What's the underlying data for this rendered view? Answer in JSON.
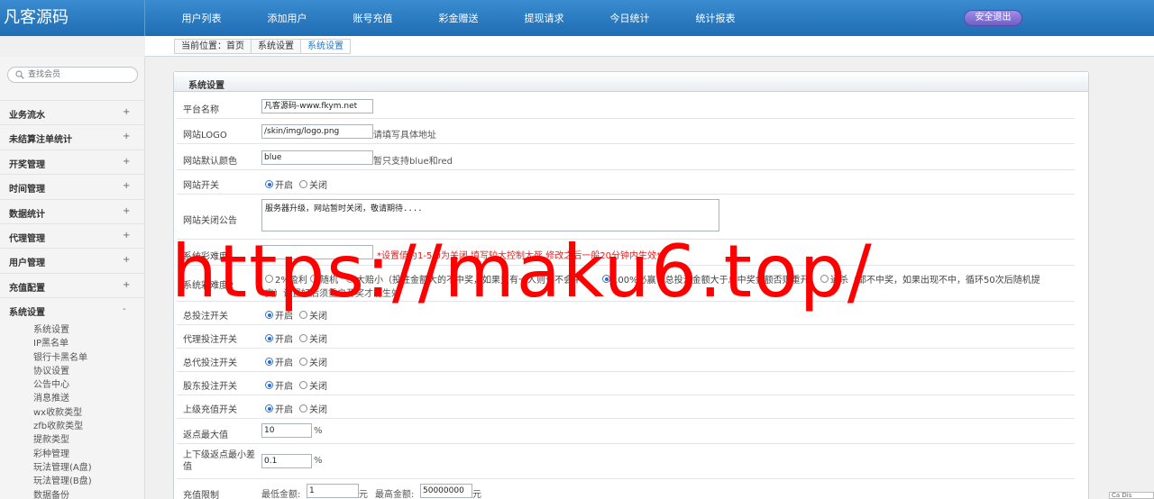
{
  "app": {
    "logo": "凡客源码"
  },
  "nav": [
    "用户列表",
    "添加用户",
    "账号充值",
    "彩金赠送",
    "提现请求",
    "今日统计",
    "统计报表"
  ],
  "logout_label": "安全退出",
  "breadcrumb": [
    "当前位置：首页",
    "系统设置",
    "系统设置"
  ],
  "search": {
    "placeholder": "查找会员"
  },
  "menu": [
    {
      "label": "业务流水",
      "sign": "+"
    },
    {
      "label": "未结算注单统计",
      "sign": "+"
    },
    {
      "label": "开奖管理",
      "sign": "+"
    },
    {
      "label": "时间管理",
      "sign": "+"
    },
    {
      "label": "数据统计",
      "sign": "+"
    },
    {
      "label": "代理管理",
      "sign": "+"
    },
    {
      "label": "用户管理",
      "sign": "+"
    },
    {
      "label": "充值配置",
      "sign": "+"
    },
    {
      "label": "系统设置",
      "sign": "-"
    }
  ],
  "submenu": [
    "系统设置",
    "IP黑名单",
    "银行卡黑名单",
    "协议设置",
    "公告中心",
    "消息推送",
    "wx收款类型",
    "zfb收款类型",
    "提款类型",
    "彩种管理",
    "玩法管理(A盘)",
    "玩法管理(B盘)",
    "数据备份"
  ],
  "panel": {
    "title": "系统设置",
    "platform_name": {
      "label": "平台名称",
      "value": "凡客源码-www.fkym.net"
    },
    "site_logo": {
      "label": "网站LOGO",
      "value": "/skin/img/logo.png",
      "note": "请填写具体地址"
    },
    "site_color": {
      "label": "网站默认颜色",
      "value": "blue",
      "note": "暂只支持blue和red"
    },
    "site_switch": {
      "label": "网站开关",
      "on": "开启",
      "off": "关闭"
    },
    "close_notice": {
      "label": "网站关闭公告",
      "value": "服务器升级，网站暂时关闭，敬请期待...."
    },
    "difficulty": {
      "label": "系统彩难度",
      "value": "",
      "note": "*设置值为1-5,0为关闭,填写较大控制太死,修改之后一般20分钟内生效*"
    },
    "difficulty2": {
      "label": "系统彩难度2",
      "options": [
        "2%盈利",
        "随机",
        "大赔小（投注金额大的不中奖，如果只有一人则也不会中）",
        "100%必赢（总投注金额大于总中奖金额否则重开）",
        "通杀（都不中奖，如果出现不中，循环50次后随机提"
      ],
      "note2": "交）设置好后须重启开奖才能生效"
    },
    "bet_total": {
      "label": "总投注开关",
      "on": "开启",
      "off": "关闭"
    },
    "bet_agent": {
      "label": "代理投注开关",
      "on": "开启",
      "off": "关闭"
    },
    "bet_general": {
      "label": "总代投注开关",
      "on": "开启",
      "off": "关闭"
    },
    "bet_holder": {
      "label": "股东投注开关",
      "on": "开启",
      "off": "关闭"
    },
    "upper_recharge": {
      "label": "上级充值开关",
      "on": "开启",
      "off": "关闭"
    },
    "rebate_max": {
      "label": "返点最大值",
      "value": "10",
      "unit": "%"
    },
    "rebate_diff": {
      "label": "上下级返点最小差值",
      "value": "0.1",
      "unit": "%"
    },
    "recharge_limit": {
      "label": "充值限制",
      "min_label": "最低金额:",
      "min_value": "1",
      "unit": "元",
      "max_label": "最高金额:",
      "max_value": "50000000",
      "unit2": "元"
    }
  },
  "watermark": "https://maku6.top/",
  "corner_text": "Ca Dis"
}
